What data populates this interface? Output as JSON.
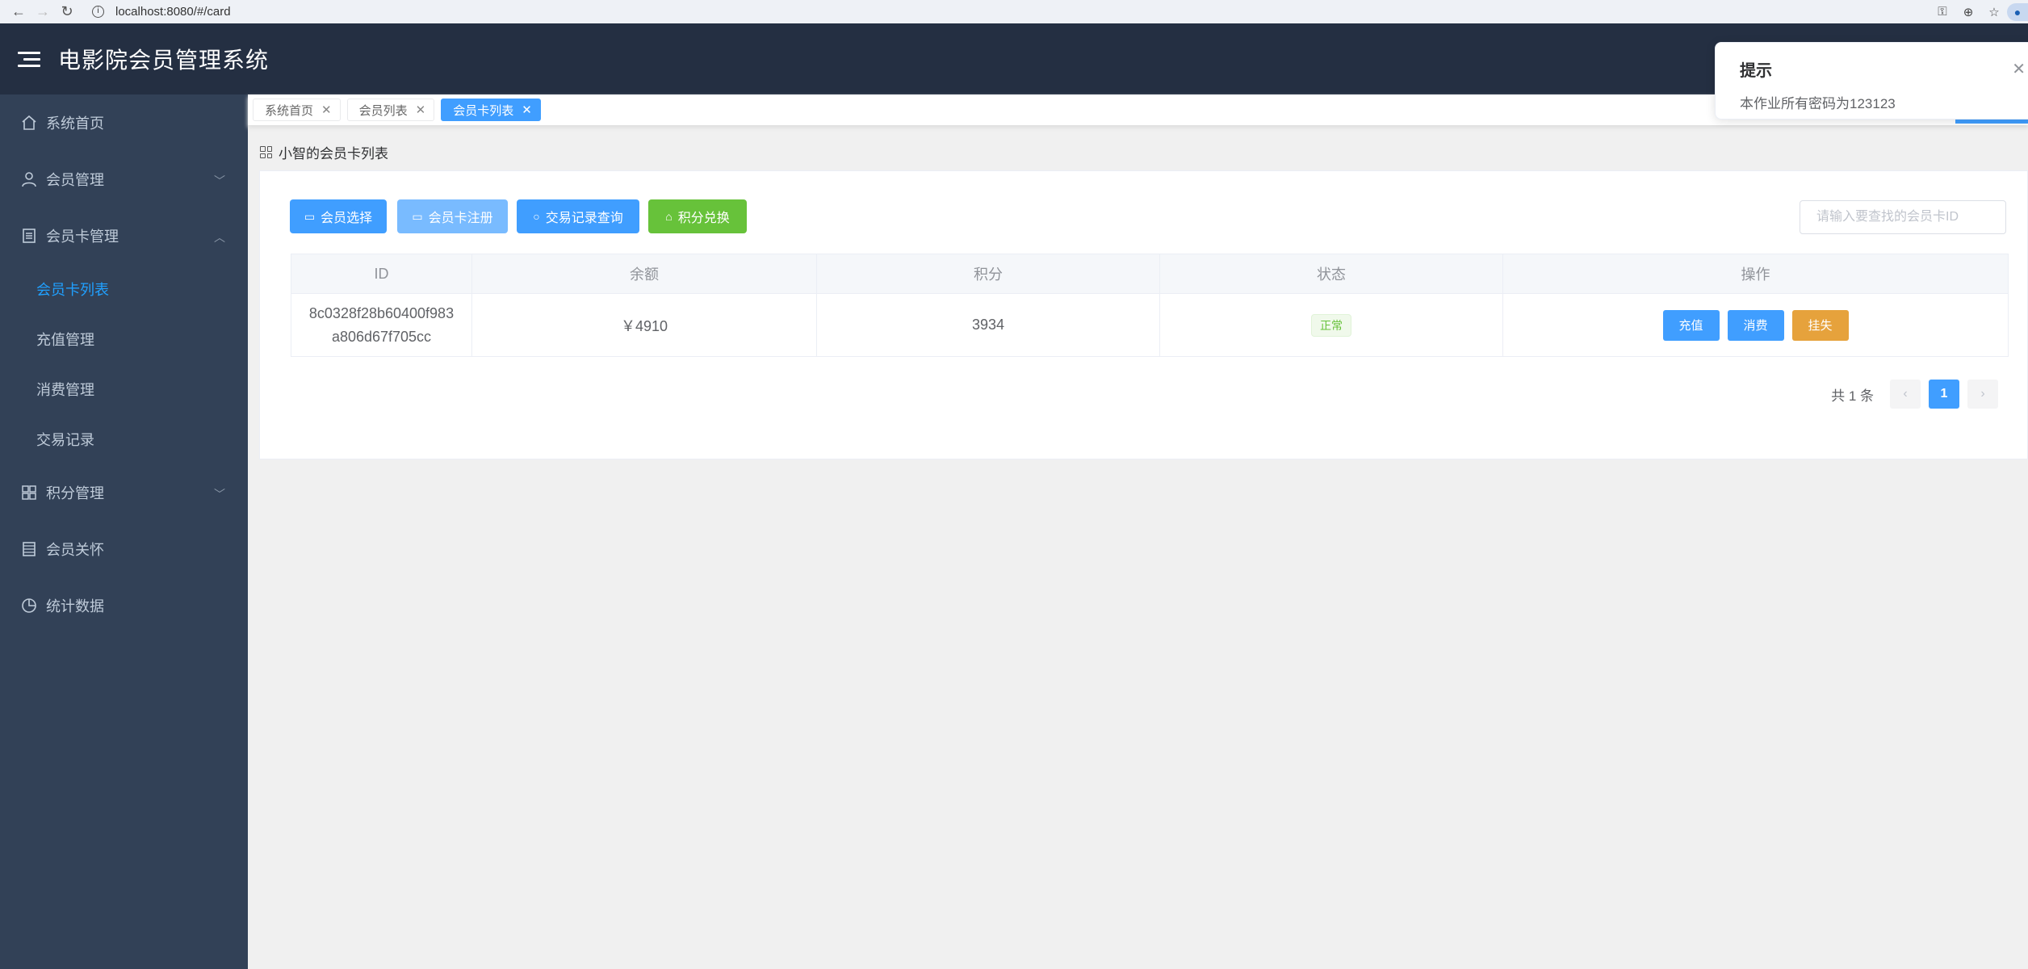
{
  "browser": {
    "url": "localhost:8080/#/card",
    "back_icon": "arrow-left-icon",
    "forward_icon": "arrow-right-icon",
    "reload_icon": "reload-icon"
  },
  "header": {
    "title": "电影院会员管理系统"
  },
  "sidebar": {
    "items": [
      {
        "label": "系统首页",
        "icon": "home-icon"
      },
      {
        "label": "会员管理",
        "icon": "user-icon"
      },
      {
        "label": "会员卡管理",
        "icon": "document-icon"
      },
      {
        "label": "积分管理",
        "icon": "grid-icon"
      },
      {
        "label": "会员关怀",
        "icon": "notebook-icon"
      },
      {
        "label": "统计数据",
        "icon": "pie-chart-icon"
      }
    ],
    "sub_items": [
      {
        "label": "会员卡列表",
        "active": true
      },
      {
        "label": "充值管理"
      },
      {
        "label": "消费管理"
      },
      {
        "label": "交易记录"
      }
    ]
  },
  "tags": [
    {
      "label": "系统首页"
    },
    {
      "label": "会员列表"
    },
    {
      "label": "会员卡列表",
      "active": true
    }
  ],
  "crumb": {
    "label": "小智的会员卡列表"
  },
  "toolbar": {
    "select_member": "会员选择",
    "register_card": "会员卡注册",
    "query_records": "交易记录查询",
    "points_exchange": "积分兑换",
    "search_placeholder": "请输入要查找的会员卡ID"
  },
  "table": {
    "headers": [
      "ID",
      "余额",
      "积分",
      "状态",
      "操作"
    ],
    "rows": [
      {
        "id_line1": "8c0328f28b60400f983",
        "id_line2": "a806d67f705cc",
        "balance": "￥4910",
        "points": "3934",
        "status": "正常",
        "actions": [
          "充值",
          "消费",
          "挂失"
        ]
      }
    ]
  },
  "pagination": {
    "total": "共 1 条",
    "current": "1"
  },
  "notification": {
    "title": "提示",
    "message": "本作业所有密码为123123"
  },
  "colors": {
    "primary": "#409eff",
    "success": "#67c23a",
    "warning": "#e6a23c",
    "sidebar_bg": "#324157",
    "header_bg": "#242f42"
  }
}
